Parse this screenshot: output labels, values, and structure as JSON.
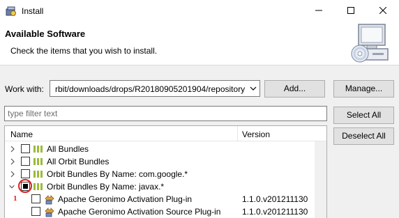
{
  "window": {
    "title": "Install",
    "icon": "eclipse-install-icon"
  },
  "banner": {
    "title": "Available Software",
    "message": "Check the items that you wish to install."
  },
  "work_with": {
    "label": "Work with:",
    "value": "rbit/downloads/drops/R20180905201904/repository",
    "add_label": "Add...",
    "manage_label": "Manage..."
  },
  "filter": {
    "placeholder": "type filter text"
  },
  "buttons": {
    "select_all": "Select All",
    "deselect_all": "Deselect All"
  },
  "tree": {
    "columns": {
      "name": "Name",
      "version": "Version"
    },
    "rows": [
      {
        "label": "All Bundles",
        "version": ""
      },
      {
        "label": "All Orbit Bundles",
        "version": ""
      },
      {
        "label": "Orbit Bundles By Name: com.google.*",
        "version": ""
      },
      {
        "label": "Orbit Bundles By Name: javax.*",
        "version": ""
      },
      {
        "label": "Apache Geronimo Activation Plug-in",
        "version": "1.1.0.v201211130"
      },
      {
        "label": "Apache Geronimo Activation Source Plug-in",
        "version": "1.1.0.v201211130"
      }
    ]
  },
  "annotation": {
    "number": "1",
    "color": "#e02020"
  }
}
